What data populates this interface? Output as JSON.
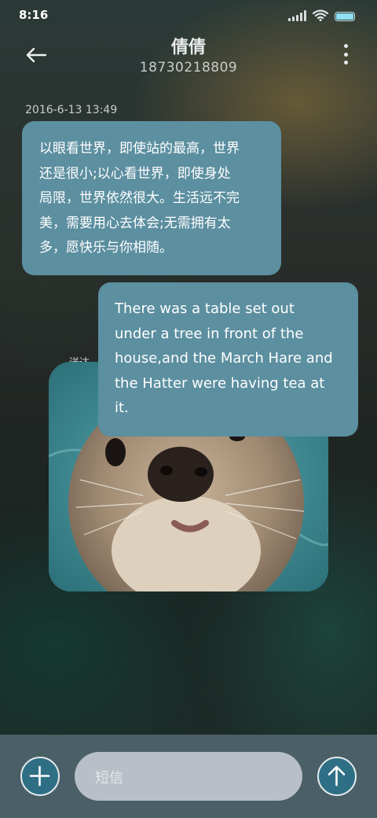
{
  "status_bar": {
    "time": "8:16",
    "icons": [
      "signal-icon",
      "wifi-icon",
      "battery-icon"
    ]
  },
  "header": {
    "contact_name": "倩倩",
    "contact_number": "18730218809",
    "icons": [
      "back-arrow-icon",
      "more-vertical-icon"
    ]
  },
  "conversation": {
    "timestamp": "2016-6-13 13:49",
    "incoming": {
      "lines": [
        "以眼看世界，即使站的最高，世界",
        "还是很小;以心看世界，即使身处",
        "局限，世界依然很大。生活远不完",
        "美，需要用心去体会;无需拥有太",
        "多，愿快乐与你相随。"
      ]
    },
    "outgoing": {
      "lines": [
        "There was a table set out",
        "under a tree in front of the",
        "house,and the March Hare and",
        "the Hatter were having tea at",
        "it."
      ]
    },
    "sent_label": "送达"
  },
  "compose": {
    "placeholder": "短信",
    "icons": [
      "plus-icon",
      "send-arrow-up-icon"
    ]
  },
  "colors": {
    "bubble": "#5c8fa0",
    "input_bar": "#4a5f66",
    "button_fill": "#2f6f85"
  }
}
